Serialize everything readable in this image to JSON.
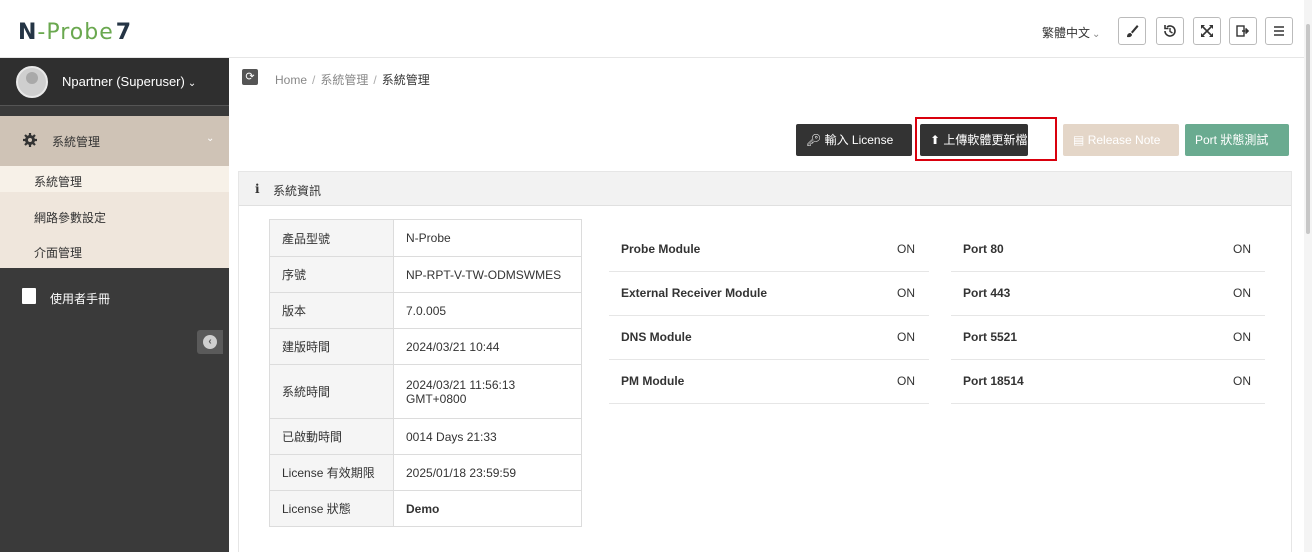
{
  "header": {
    "logo": {
      "part1": "N",
      "part2": "-Probe",
      "part3": "7"
    },
    "language": "繁體中文"
  },
  "sidebar": {
    "user": "Npartner (Superuser)",
    "section": "系統管理",
    "items": [
      {
        "label": "系統管理"
      },
      {
        "label": "網路參數設定"
      },
      {
        "label": "介面管理"
      }
    ],
    "manual": "使用者手冊"
  },
  "breadcrumb": [
    "Home",
    "系統管理",
    "系統管理"
  ],
  "actions": {
    "license": "輸入 License",
    "upload": "上傳軟體更新檔",
    "release": "Release Note",
    "port_test": "Port 狀態測試"
  },
  "panel": {
    "title": "系統資訊",
    "info": [
      {
        "key": "產品型號",
        "value": "N-Probe"
      },
      {
        "key": "序號",
        "value": "NP-RPT-V-TW-ODMSWMES"
      },
      {
        "key": "版本",
        "value": "7.0.005"
      },
      {
        "key": "建版時間",
        "value": "2024/03/21 10:44"
      },
      {
        "key": "系統時間",
        "value": "2024/03/21 11:56:13 GMT+0800"
      },
      {
        "key": "已啟動時間",
        "value": "0014 Days 21:33"
      },
      {
        "key": "License 有效期限",
        "value": "2025/01/18 23:59:59"
      },
      {
        "key": "License 狀態",
        "value": "Demo"
      }
    ],
    "modules": [
      {
        "name": "Probe Module",
        "status": "ON"
      },
      {
        "name": "External Receiver Module",
        "status": "ON"
      },
      {
        "name": "DNS Module",
        "status": "ON"
      },
      {
        "name": "PM Module",
        "status": "ON"
      }
    ],
    "ports": [
      {
        "name": "Port 80",
        "status": "ON"
      },
      {
        "name": "Port 443",
        "status": "ON"
      },
      {
        "name": "Port 5521",
        "status": "ON"
      },
      {
        "name": "Port 18514",
        "status": "ON"
      }
    ]
  }
}
